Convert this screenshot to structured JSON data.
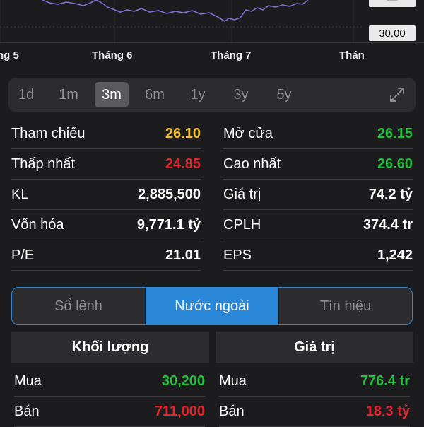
{
  "chart": {
    "price_labels": [
      "30.00"
    ],
    "x_labels": [
      "ng 5",
      "Tháng 6",
      "Tháng 7",
      "Thán"
    ],
    "line_color": "#7b6fd0"
  },
  "range_selector": {
    "options": [
      "1d",
      "1m",
      "3m",
      "6m",
      "1y",
      "3y",
      "5y"
    ],
    "selected": "3m",
    "expand_icon": "expand-icon"
  },
  "stats": {
    "left": [
      {
        "label": "Tham chiếu",
        "value": "26.10",
        "color": "#f5c02a"
      },
      {
        "label": "Thấp nhất",
        "value": "24.85",
        "color": "#e0262f"
      },
      {
        "label": "KL",
        "value": "2,885,500",
        "color": "#ffffff"
      },
      {
        "label": "Vốn hóa",
        "value": "9,771.1 tỷ",
        "color": "#ffffff"
      },
      {
        "label": "P/E",
        "value": "21.01",
        "color": "#ffffff"
      }
    ],
    "right": [
      {
        "label": "Mở cửa",
        "value": "26.15",
        "color": "#22c03b"
      },
      {
        "label": "Cao nhất",
        "value": "26.60",
        "color": "#22c03b"
      },
      {
        "label": "Giá trị",
        "value": "74.2 tỷ",
        "color": "#ffffff"
      },
      {
        "label": "CPLH",
        "value": "374.4 tr",
        "color": "#ffffff"
      },
      {
        "label": "EPS",
        "value": "1,242",
        "color": "#ffffff"
      }
    ]
  },
  "tabs": {
    "items": [
      "Sổ lệnh",
      "Nước ngoài",
      "Tín hiệu"
    ],
    "active": "Nước ngoài"
  },
  "foreign": {
    "volume_header": "Khối lượng",
    "value_header": "Giá trị",
    "volume_rows": [
      {
        "label": "Mua",
        "value": "30,200",
        "color": "#22c03b"
      },
      {
        "label": "Bán",
        "value": "711,000",
        "color": "#e0262f"
      }
    ],
    "value_rows": [
      {
        "label": "Mua",
        "value": "776.4 tr",
        "color": "#22c03b"
      },
      {
        "label": "Bán",
        "value": "18.3 tỷ",
        "color": "#e0262f"
      }
    ]
  }
}
